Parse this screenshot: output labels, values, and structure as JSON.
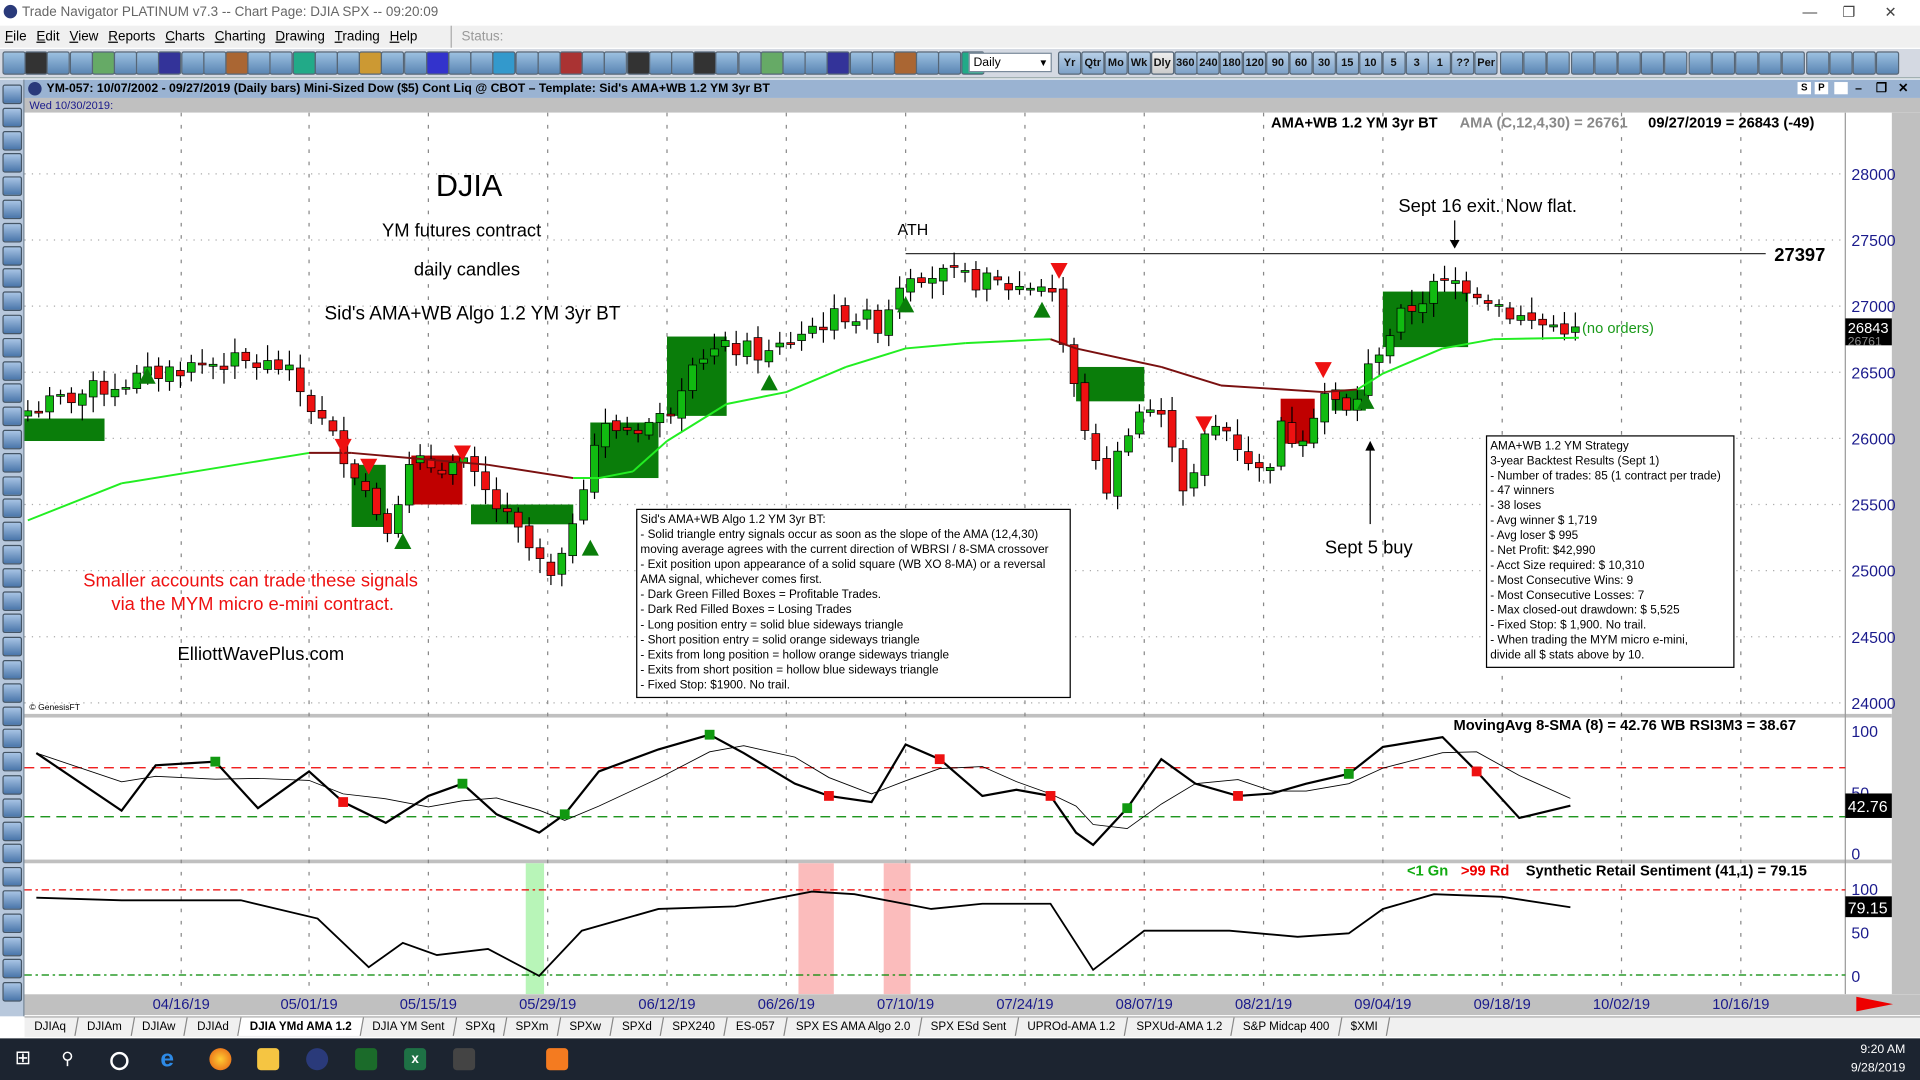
{
  "window": {
    "title": "Trade Navigator PLATINUM v7.3  --  Chart Page: DJIA SPX -- 09:20:09"
  },
  "menu": [
    "File",
    "Edit",
    "View",
    "Reports",
    "Charts",
    "Charting",
    "Drawing",
    "Trading",
    "Help"
  ],
  "status_label": "Status:",
  "toolbar": {
    "period_value": "Daily",
    "period_buttons": [
      "Yr",
      "Qtr",
      "Mo",
      "Wk",
      "Dly",
      "360",
      "240",
      "180",
      "120",
      "90",
      "60",
      "30",
      "15",
      "10",
      "5",
      "3",
      "1",
      "??",
      "Per"
    ],
    "selected_period": "Dly"
  },
  "chart_header": {
    "text": "YM-057:  10/07/2002 - 09/27/2019  (Daily bars)   Mini-Sized Dow ($5) Cont Liq @ CBOT  –  Template: Sid's AMA+WB 1.2 YM 3yr BT",
    "buttons": [
      "S",
      "P"
    ]
  },
  "cursor_date": "Wed  10/30/2019:",
  "price_panel": {
    "study": "AMA+WB 1.2 YM 3yr BT",
    "ama": "AMA (C,12,4,30) = 26761",
    "last": "09/27/2019 = 26843 (-49)",
    "last_badge": "26843",
    "ama_badge": "26761",
    "copyright": "© GenesisFT",
    "annotations": {
      "title": "DJIA",
      "line1": "YM futures contract",
      "line2": "daily candles",
      "line3": "Sid's AMA+WB Algo 1.2 YM 3yr BT",
      "ath": "ATH",
      "ath_level": "27397",
      "exit_note": "Sept 16 exit. Now flat.",
      "buy_note": "Sept 5 buy",
      "no_orders": "(no orders)",
      "micro_line1": "Smaller accounts can trade these signals",
      "micro_line2": "via the MYM micro e-mini contract.",
      "site": "ElliottWavePlus.com"
    },
    "legend_box": [
      "Sid's AMA+WB Algo 1.2 YM 3yr BT:",
      "- Solid triangle entry signals occur as soon as the slope of the AMA (12,4,30)",
      "moving average agrees with the current direction of WBRSI / 8-SMA crossover",
      "- Exit position upon appearance of a solid square (WB XO 8-MA) or a reversal",
      "AMA signal, whichever comes first.",
      "- Dark Green Filled Boxes = Profitable Trades.",
      "- Dark Red Filled Boxes = Losing Trades",
      "- Long position entry = solid blue sideways triangle",
      "- Short position entry = solid orange sideways triangle",
      "- Exits from long position = hollow orange sideways triangle",
      "- Exits from short position = hollow blue sideways triangle",
      "- Fixed Stop: $1900.  No trail."
    ],
    "stats_box": [
      "AMA+WB 1.2 YM Strategy",
      "3-year Backtest Results (Sept 1)",
      "- Number of trades: 85 (1 contract per trade)",
      "- 47 winners",
      "- 38 loses",
      "- Avg winner $ 1,719",
      "- Avg loser $ 995",
      "- Net Profit: $42,990",
      "- Acct Size required: $ 10,310",
      "- Most Consecutive Wins: 9",
      "- Most Consecutive Losses: 7",
      "- Max closed-out drawdown: $ 5,525",
      "- Fixed Stop: $ 1,900.  No trail.",
      "- When trading the MYM micro e-mini,",
      "divide all $ stats above by 10."
    ]
  },
  "osc_panel": {
    "label": "MovingAvg 8-SMA (8) = 42.76   WB RSI3M3 = 38.67",
    "badge": "42.76"
  },
  "sent_panel": {
    "green_label": "<1 Gn",
    "red_label": ">99 Rd",
    "label": "Synthetic Retail Sentiment (41,1) = 79.15",
    "badge": "79.15"
  },
  "chart_data": [
    {
      "type": "candlestick",
      "year": 2019,
      "x_ticks": [
        "04/16/19",
        "05/01/19",
        "05/15/19",
        "05/29/19",
        "06/12/19",
        "06/26/19",
        "07/10/19",
        "07/24/19",
        "08/07/19",
        "08/21/19",
        "09/04/19",
        "09/18/19",
        "10/02/19",
        "10/16/19"
      ],
      "y_ticks": [
        24000,
        24500,
        25000,
        25500,
        26000,
        26500,
        27000,
        27500,
        28000
      ],
      "ylim": [
        24000,
        28000
      ],
      "grid": true,
      "closes": [
        [
          "03/29",
          26210
        ],
        [
          "04/05",
          26350
        ],
        [
          "04/16",
          26540
        ],
        [
          "04/21",
          26580
        ],
        [
          "04/28",
          26540
        ],
        [
          "05/02",
          26170
        ],
        [
          "05/06",
          25800
        ],
        [
          "05/10",
          25330
        ],
        [
          "05/13",
          25800
        ],
        [
          "05/19",
          25800
        ],
        [
          "05/22",
          25560
        ],
        [
          "05/26",
          25240
        ],
        [
          "05/30",
          24870
        ],
        [
          "06/01",
          25425
        ],
        [
          "06/04",
          26075
        ],
        [
          "06/08",
          26075
        ],
        [
          "06/12",
          26170
        ],
        [
          "06/15",
          26630
        ],
        [
          "06/20",
          26680
        ],
        [
          "06/24",
          26630
        ],
        [
          "06/28",
          26815
        ],
        [
          "07/03",
          26950
        ],
        [
          "07/07",
          26860
        ],
        [
          "07/10",
          27280
        ],
        [
          "07/14",
          27230
        ],
        [
          "07/19",
          27185
        ],
        [
          "07/23",
          27140
        ],
        [
          "07/27",
          27185
        ],
        [
          "07/29",
          26540
        ],
        [
          "08/01",
          25890
        ],
        [
          "08/02",
          25520
        ],
        [
          "08/05",
          26075
        ],
        [
          "08/07",
          26260
        ],
        [
          "08/10",
          26075
        ],
        [
          "08/12",
          25520
        ],
        [
          "08/14",
          25980
        ],
        [
          "08/16",
          26120
        ],
        [
          "08/21",
          25700
        ],
        [
          "08/23",
          26075
        ],
        [
          "08/25",
          25980
        ],
        [
          "08/28",
          26350
        ],
        [
          "08/31",
          26170
        ],
        [
          "09/03",
          26630
        ],
        [
          "09/06",
          26910
        ],
        [
          "09/10",
          27140
        ],
        [
          "09/13",
          27185
        ],
        [
          "09/16",
          27090
        ],
        [
          "09/19",
          26950
        ],
        [
          "09/22",
          26860
        ],
        [
          "09/27",
          26843
        ]
      ],
      "ama": [
        [
          "03/29",
          25380,
          "up"
        ],
        [
          "04/09",
          25660,
          "up"
        ],
        [
          "05/01",
          25890,
          "up"
        ],
        [
          "05/06",
          25890,
          "down"
        ],
        [
          "05/22",
          25800,
          "down"
        ],
        [
          "06/01",
          25700,
          "down"
        ],
        [
          "06/04",
          25700,
          "up"
        ],
        [
          "06/08",
          25750,
          "up"
        ],
        [
          "06/12",
          25980,
          "up"
        ],
        [
          "06/19",
          26260,
          "up"
        ],
        [
          "06/26",
          26350,
          "up"
        ],
        [
          "07/03",
          26540,
          "up"
        ],
        [
          "07/10",
          26680,
          "up"
        ],
        [
          "07/17",
          26720,
          "up"
        ],
        [
          "07/27",
          26750,
          "up"
        ],
        [
          "07/30",
          26680,
          "down"
        ],
        [
          "08/09",
          26540,
          "down"
        ],
        [
          "08/16",
          26400,
          "down"
        ],
        [
          "08/28",
          26350,
          "down"
        ],
        [
          "09/01",
          26370,
          "down"
        ],
        [
          "09/04",
          26490,
          "up"
        ],
        [
          "09/11",
          26680,
          "up"
        ],
        [
          "09/17",
          26750,
          "up"
        ],
        [
          "09/27",
          26761,
          "up"
        ]
      ],
      "ama_colors": {
        "up": "#22ee22",
        "down": "#7a1010"
      },
      "ath_level": 27397,
      "trade_boxes": [
        [
          "03/27",
          "04/07",
          26150,
          25980,
          "win"
        ],
        [
          "05/06",
          "05/10",
          25800,
          25330,
          "win"
        ],
        [
          "05/13",
          "05/19",
          25870,
          25500,
          "loss"
        ],
        [
          "05/20",
          "06/01",
          25500,
          25350,
          "win"
        ],
        [
          "06/03",
          "06/11",
          26120,
          25700,
          "win"
        ],
        [
          "06/12",
          "06/19",
          26770,
          26170,
          "win"
        ],
        [
          "07/30",
          "08/07",
          26540,
          26280,
          "win"
        ],
        [
          "08/23",
          "08/27",
          26300,
          25960,
          "loss"
        ],
        [
          "08/29",
          "09/02",
          26370,
          26210,
          "win"
        ],
        [
          "09/04",
          "09/14",
          27110,
          26690,
          "win"
        ]
      ],
      "box_colors": {
        "win": "#0a7d0a",
        "loss": "#c00000"
      },
      "signals": [
        [
          "04/12",
          26450,
          "long"
        ],
        [
          "05/05",
          25950,
          "short"
        ],
        [
          "05/08",
          25800,
          "short"
        ],
        [
          "05/19",
          25900,
          "short"
        ],
        [
          "05/12",
          25200,
          "long"
        ],
        [
          "06/03",
          25150,
          "long"
        ],
        [
          "06/24",
          26400,
          "long"
        ],
        [
          "07/10",
          26990,
          "long"
        ],
        [
          "07/26",
          26950,
          "long"
        ],
        [
          "07/28",
          27280,
          "short"
        ],
        [
          "08/14",
          26120,
          "short"
        ],
        [
          "08/28",
          26530,
          "short"
        ],
        [
          "09/02",
          26260,
          "long"
        ]
      ]
    },
    {
      "type": "line",
      "ylim": [
        0,
        100
      ],
      "y_ticks": [
        0,
        50,
        100
      ],
      "levels": {
        "upper": 70,
        "lower": 30
      },
      "rsi": [
        [
          "03/30",
          82
        ],
        [
          "04/09",
          35
        ],
        [
          "04/13",
          72
        ],
        [
          "04/20",
          75
        ],
        [
          "04/25",
          37
        ],
        [
          "05/01",
          67
        ],
        [
          "05/05",
          42
        ],
        [
          "05/10",
          25
        ],
        [
          "05/15",
          47
        ],
        [
          "05/19",
          57
        ],
        [
          "05/23",
          32
        ],
        [
          "05/28",
          17
        ],
        [
          "05/31",
          32
        ],
        [
          "06/04",
          67
        ],
        [
          "06/11",
          85
        ],
        [
          "06/17",
          97
        ],
        [
          "06/21",
          82
        ],
        [
          "06/27",
          57
        ],
        [
          "07/01",
          47
        ],
        [
          "07/06",
          42
        ],
        [
          "07/10",
          89
        ],
        [
          "07/14",
          77
        ],
        [
          "07/19",
          47
        ],
        [
          "07/23",
          52
        ],
        [
          "07/27",
          47
        ],
        [
          "07/30",
          17
        ],
        [
          "08/01",
          7
        ],
        [
          "08/05",
          37
        ],
        [
          "08/09",
          77
        ],
        [
          "08/13",
          57
        ],
        [
          "08/18",
          47
        ],
        [
          "08/22",
          49
        ],
        [
          "08/26",
          57
        ],
        [
          "08/31",
          65
        ],
        [
          "09/04",
          87
        ],
        [
          "09/11",
          95
        ],
        [
          "09/15",
          67
        ],
        [
          "09/20",
          29
        ],
        [
          "09/26",
          39
        ]
      ]
    },
    {
      "type": "line",
      "ylim": [
        0,
        100
      ],
      "y_ticks": [
        0,
        50,
        100
      ],
      "levels": {
        "upper": 99,
        "lower": 1
      },
      "sentiment": [
        [
          "03/30",
          90
        ],
        [
          "04/09",
          87
        ],
        [
          "04/23",
          87
        ],
        [
          "05/02",
          66
        ],
        [
          "05/08",
          10
        ],
        [
          "05/12",
          38
        ],
        [
          "05/16",
          24
        ],
        [
          "05/22",
          31
        ],
        [
          "05/28",
          0
        ],
        [
          "06/02",
          52
        ],
        [
          "06/11",
          77
        ],
        [
          "06/20",
          80
        ],
        [
          "06/29",
          97
        ],
        [
          "07/04",
          94
        ],
        [
          "07/13",
          77
        ],
        [
          "07/19",
          83
        ],
        [
          "07/27",
          83
        ],
        [
          "08/01",
          7
        ],
        [
          "08/07",
          52
        ],
        [
          "08/17",
          52
        ],
        [
          "08/25",
          45
        ],
        [
          "08/31",
          49
        ],
        [
          "09/04",
          77
        ],
        [
          "09/10",
          94
        ],
        [
          "09/18",
          91
        ],
        [
          "09/26",
          79
        ]
      ],
      "highlight_bands": [
        [
          "05/27",
          "05/28",
          "green"
        ],
        [
          "06/28",
          "07/01",
          "red"
        ],
        [
          "07/08",
          "07/10",
          "red"
        ]
      ]
    }
  ],
  "tabs": [
    "DJIAq",
    "DJIAm",
    "DJIAw",
    "DJIAd",
    "DJIA YMd AMA 1.2",
    "DJIA YM Sent",
    "SPXq",
    "SPXm",
    "SPXw",
    "SPXd",
    "SPX240",
    "ES-057",
    "SPX ES AMA Algo 2.0",
    "SPX ESd Sent",
    "UPROd-AMA 1.2",
    "SPXUd-AMA 1.2",
    "S&P Midcap 400",
    "$XMI"
  ],
  "active_tab": "DJIA YMd AMA 1.2",
  "taskbar": {
    "time": "9:20 AM",
    "date": "9/28/2019"
  }
}
